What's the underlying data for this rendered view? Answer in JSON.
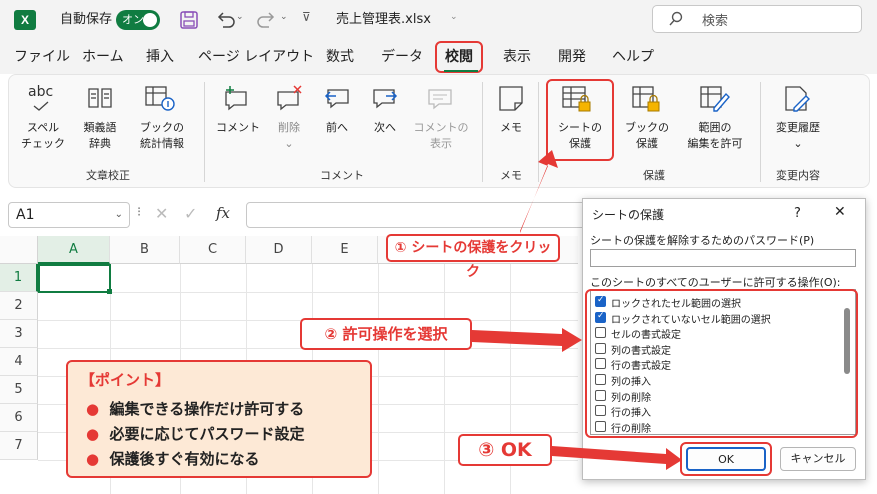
{
  "titlebar": {
    "logo": "X",
    "autosave_label": "自動保存",
    "toggle_label": "オン",
    "filename": "売上管理表.xlsx",
    "search_placeholder": "検索"
  },
  "menu": [
    "ファイル",
    "ホーム",
    "挿入",
    "ページ レイアウト",
    "数式",
    "データ",
    "校閲",
    "表示",
    "開発",
    "ヘルプ"
  ],
  "ribbon": {
    "groups": {
      "proofing": "文章校正",
      "comments": "コメント",
      "memo": "メモ",
      "protect": "保護",
      "changes": "変更内容"
    },
    "icon_abc": "abc",
    "buttons": {
      "spell": [
        "スペル",
        "チェック"
      ],
      "thesaurus": [
        "類義語",
        "辞典"
      ],
      "stats": [
        "ブックの",
        "統計情報"
      ],
      "new_comment": "コメント",
      "delete": "削除",
      "prev": "前へ",
      "next": "次へ",
      "show_comments": [
        "コメントの",
        "表示"
      ],
      "memo": "メモ",
      "protect_sheet": [
        "シートの",
        "保護"
      ],
      "protect_book": [
        "ブックの",
        "保護"
      ],
      "allow_edit": [
        "範囲の",
        "編集を許可"
      ],
      "track_changes": "変更履歴"
    }
  },
  "formula": {
    "namebox": "A1",
    "fx": "fx"
  },
  "grid": {
    "columns": [
      "A",
      "B",
      "C",
      "D",
      "E"
    ],
    "rows": [
      "1",
      "2",
      "3",
      "4",
      "5",
      "6",
      "7"
    ]
  },
  "dialog": {
    "title": "シートの保護",
    "help": "?",
    "password_label": "シートの保護を解除するためのパスワード(P)",
    "allow_label": "このシートのすべてのユーザーに許可する操作(O):",
    "options": [
      {
        "label": "ロックされたセル範囲の選択",
        "checked": true
      },
      {
        "label": "ロックされていないセル範囲の選択",
        "checked": true
      },
      {
        "label": "セルの書式設定",
        "checked": false
      },
      {
        "label": "列の書式設定",
        "checked": false
      },
      {
        "label": "行の書式設定",
        "checked": false
      },
      {
        "label": "列の挿入",
        "checked": false
      },
      {
        "label": "列の削除",
        "checked": false
      },
      {
        "label": "行の挿入",
        "checked": false
      },
      {
        "label": "行の削除",
        "checked": false
      }
    ],
    "ok": "OK",
    "cancel": "キャンセル"
  },
  "callouts": {
    "step1": "① シートの保護をクリック",
    "step2": "② 許可操作を選択",
    "step3": "③ OK"
  },
  "point": {
    "title": "【ポイント】",
    "bullet": "●",
    "lines": [
      "編集できる操作だけ許可する",
      "必要に応じてパスワード設定",
      "保護後すぐ有効になる"
    ]
  },
  "colors": {
    "accent": "#e53935",
    "excel_green": "#107c41",
    "point_bg": "#fde9d6",
    "check_blue": "#1a63c7"
  }
}
